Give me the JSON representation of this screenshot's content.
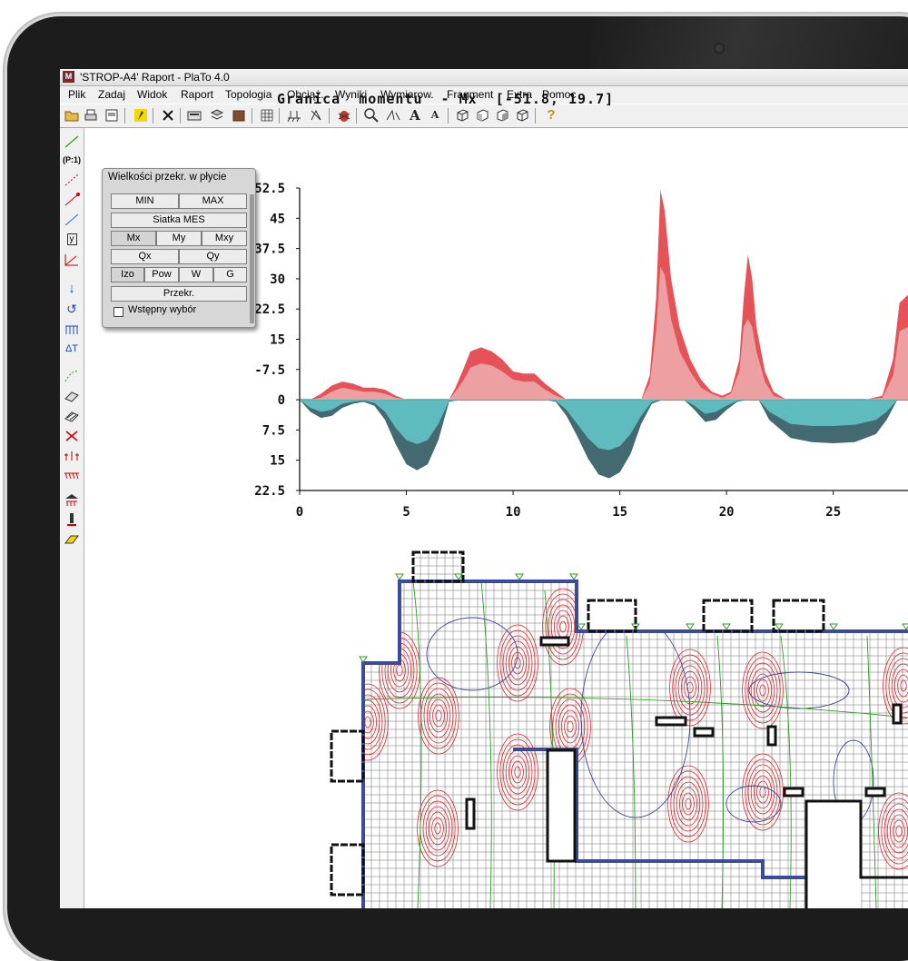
{
  "window": {
    "title": "'STROP-A4' Raport  - PlaTo 4.0",
    "app_icon": "plato-app-icon"
  },
  "menu": [
    "Plik",
    "Zadaj",
    "Widok",
    "Raport",
    "Topologia",
    "Obciąż.",
    "Wyniki",
    "Wymiarow.",
    "Fragment",
    "Extra",
    "Pomoc"
  ],
  "toolbar_icons": [
    "open-folder-icon",
    "print-icon",
    "print-preview-icon",
    "highlight-icon",
    "delete-icon",
    "calculator-icon",
    "layers-icon",
    "stack-icon",
    "grid-icon",
    "supports-icon",
    "load-icon",
    "bug-icon",
    "zoom-icon",
    "measure-icon",
    "font-larger-icon",
    "font-smaller-icon",
    "cube-view-icon",
    "cube-front-icon",
    "cube-side-icon",
    "cube-wire-icon",
    "help-icon"
  ],
  "left_toolbar_icons": [
    "line-tool-icon",
    "p1-tool-icon",
    "beam-tool-icon",
    "column-tool-icon",
    "beam-end-tool-icon",
    "y-axis-tool-icon",
    "angle-tool-icon",
    "arrow-down-tool-icon",
    "moment-tool-icon",
    "distributed-load-tool-icon",
    "temperature-tool-icon",
    "curve-tool-icon",
    "plate-tool-icon",
    "plate-load-tool-icon",
    "cross-tool-icon",
    "nodes-tool-icon",
    "multi-load-tool-icon",
    "support-tool-icon",
    "column-support-tool-icon",
    "eraser-tool-icon"
  ],
  "panel": {
    "title": "Wielkości przekr. w płycie",
    "min": "MIN",
    "max": "MAX",
    "mesh": "Siatka MES",
    "mx": "Mx",
    "my": "My",
    "mxy": "Mxy",
    "qx": "Qx",
    "qy": "Qy",
    "izo": "Izo",
    "pow": "Pow",
    "w": "W",
    "g": "G",
    "przekr": "Przekr.",
    "checkbox_label": "Wstępny wybór",
    "checkbox_checked": false
  },
  "chart_title": "Granica  momentu  - Mx  [-51.8, 19.7]",
  "chart_data": {
    "type": "area",
    "title": "Granica  momentu  - Mx  [-51.8, 19.7]",
    "xlabel": "",
    "ylabel": "",
    "xlim": [
      0,
      28.5
    ],
    "ylim": [
      -52.5,
      22.5
    ],
    "x_ticks": [
      "0",
      "5",
      "10",
      "15",
      "20",
      "25"
    ],
    "y_ticks": [
      "-52.5",
      "-45",
      "-37.5",
      "-30",
      "-22.5",
      "-15",
      "-7.5",
      "0",
      "7.5",
      "15",
      "22.5"
    ],
    "series": [
      {
        "color": "#e8585c",
        "x": [
          0,
          0.5,
          1,
          1.5,
          2,
          2.5,
          3,
          3.5,
          4,
          4.5,
          5,
          5.5,
          6,
          6.5,
          7,
          7.3,
          7.7,
          8,
          8.5,
          9,
          9.5,
          10,
          10.5,
          11,
          11.5,
          12,
          12.5,
          13,
          13.5,
          14,
          14.5,
          15,
          15.5,
          16,
          16.4,
          16.7,
          16.9,
          17.1,
          17.4,
          17.8,
          18.3,
          18.8,
          19.3,
          19.8,
          20.2,
          20.6,
          20.8,
          21,
          21.2,
          21.4,
          21.8,
          22.2,
          22.8,
          23.5,
          24.5,
          25.5,
          26.5,
          27.3,
          27.8,
          28.1,
          28.5
        ],
        "upper": [
          0,
          0,
          -1.5,
          -3.5,
          -4.5,
          -4,
          -3,
          -3,
          -2.5,
          -1,
          0,
          0,
          0,
          0,
          0,
          -3,
          -8,
          -12,
          -13,
          -12,
          -10,
          -7,
          -6.5,
          -6.5,
          -4,
          -2,
          0,
          0,
          0,
          0,
          0,
          0,
          0,
          0,
          -6,
          -25,
          -52,
          -47,
          -30,
          -18,
          -10,
          -5,
          -2,
          -1,
          -2,
          -10,
          -25,
          -36,
          -30,
          -18,
          -7,
          -2,
          0,
          0,
          0,
          0,
          0,
          -1,
          -10,
          -24,
          -26
        ],
        "inner": [
          0,
          0,
          -0.5,
          -2,
          -3,
          -2.5,
          -2,
          -2,
          -1.5,
          -0.5,
          0,
          0,
          0,
          0,
          0,
          -2,
          -5,
          -8,
          -9,
          -8.5,
          -7,
          -5,
          -4.5,
          -4.5,
          -2.5,
          -1,
          0,
          0,
          0,
          0,
          0,
          0,
          0,
          0,
          -4,
          -17,
          -33,
          -31,
          -20,
          -12,
          -7,
          -3,
          -1.5,
          -0.5,
          -1.5,
          -7,
          -18,
          -20,
          -18,
          -12,
          -4.5,
          -1,
          0,
          0,
          0,
          0,
          0,
          -0.5,
          -6,
          -17,
          -18
        ]
      },
      {
        "color": "#5fbcbe",
        "x": [
          0,
          0.5,
          1,
          1.5,
          2,
          2.5,
          3,
          3.5,
          4,
          4.5,
          5,
          5.5,
          6,
          6.5,
          7,
          7.5,
          8,
          9,
          10,
          11,
          11.5,
          12,
          12.5,
          13,
          13.5,
          14,
          14.5,
          15,
          15.5,
          16,
          16.5,
          17,
          17.5,
          18,
          18.5,
          19,
          19.5,
          20,
          20.5,
          21,
          21.5,
          22,
          23,
          24,
          25,
          26,
          27,
          27.5,
          28
        ],
        "lower": [
          0,
          3,
          4.5,
          4,
          2,
          1,
          0.5,
          1.5,
          5,
          11,
          16,
          17.5,
          16,
          10,
          0.5,
          0,
          0,
          0,
          0,
          0,
          0,
          0.5,
          4,
          9,
          14.5,
          18.5,
          19.5,
          18,
          13.5,
          6,
          1,
          0,
          0,
          0,
          2.5,
          5.5,
          5,
          2.5,
          0.5,
          0,
          0,
          5,
          9.5,
          10.5,
          10.8,
          10.5,
          8.5,
          5,
          0
        ],
        "inner": [
          0,
          2,
          3,
          2.5,
          1,
          0.5,
          0.2,
          0.8,
          3,
          7,
          10,
          11,
          10,
          6,
          0.3,
          0,
          0,
          0,
          0,
          0,
          0,
          0.3,
          2.5,
          6,
          9.5,
          12,
          12.5,
          11.5,
          8.5,
          4,
          0.5,
          0,
          0,
          0,
          1.5,
          3.5,
          3,
          1.5,
          0.3,
          0,
          0,
          3,
          6,
          6.5,
          6.5,
          6.2,
          5,
          3,
          0
        ]
      }
    ]
  },
  "plan_legend": [
    "#1a8ed6",
    "#e0242a",
    "#2e9a2a",
    "#3b4a9a"
  ]
}
